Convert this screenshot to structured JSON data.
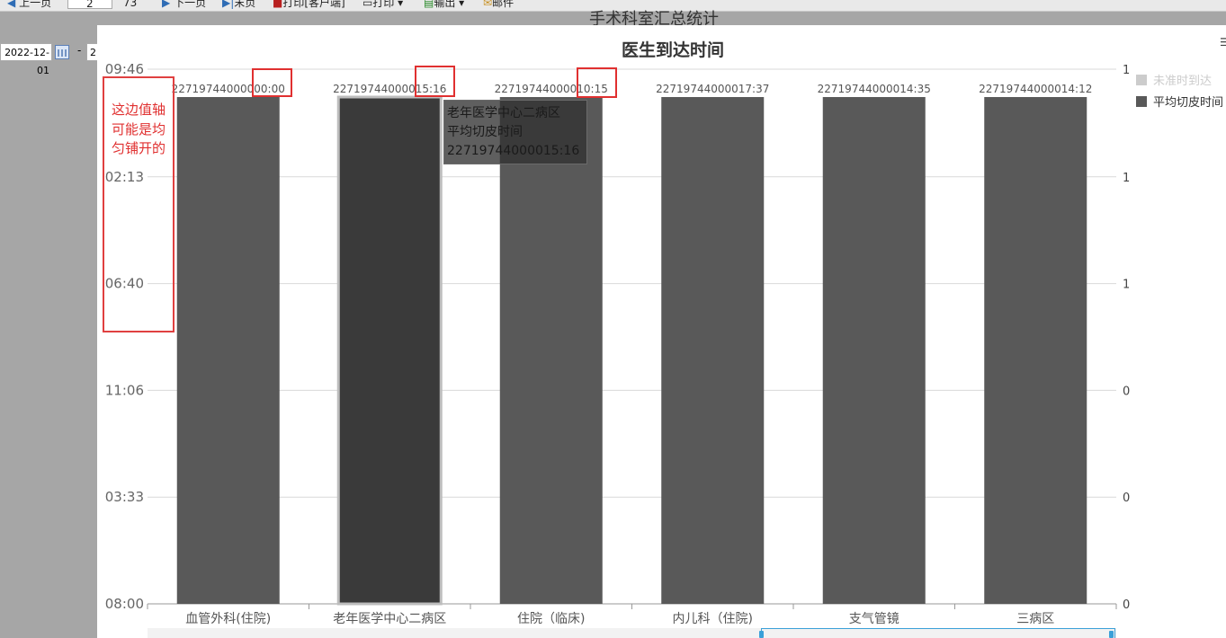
{
  "toolbar": {
    "prev": "上一页",
    "page_current": "2",
    "page_total": "73",
    "next": "下一页",
    "last": "末页",
    "print_client": "打印[客户端]",
    "print": "打印",
    "export": "输出",
    "mail": "邮件"
  },
  "report_title_behind": "手术科室汇总统计",
  "filter": {
    "date_from": "2022-12-01",
    "date_sep": "-",
    "date_to": "2"
  },
  "annotation": {
    "note": "这边值轴可能是均匀铺开的",
    "color": "#e03030"
  },
  "tooltip": {
    "category": "老年医学中心二病区",
    "series": "平均切皮时间",
    "value": "22719744000015:16"
  },
  "chart_data": {
    "type": "bar",
    "title": "医生到达时间",
    "categories": [
      "血管外科(住院)",
      "老年医学中心二病区",
      "住院（临床)",
      "内儿科（住院)",
      "支气管镜",
      "三病区"
    ],
    "series": [
      {
        "name": "未准时到达",
        "color": "#cccccc",
        "values": [],
        "axis": "right"
      },
      {
        "name": "平均切皮时间",
        "color": "#595959",
        "values": [
          1,
          1,
          1,
          1,
          1,
          1
        ],
        "labels": [
          "22719744000000:00",
          "22719744000015:16",
          "22719744000010:15",
          "22719744000017:37",
          "22719744000014:35",
          "22719744000014:12"
        ]
      }
    ],
    "y_left_ticks": [
      "08:00",
      "03:33",
      "11:06",
      "06:40",
      "02:13",
      "09:46"
    ],
    "y_right_ticks": [
      "0",
      "0",
      "0",
      "1",
      "1",
      "1"
    ],
    "ylim": [
      0,
      1
    ],
    "grid": true,
    "legend": "top-right",
    "highlighted_index": 1,
    "highlight_color": "#3a3a3a"
  }
}
